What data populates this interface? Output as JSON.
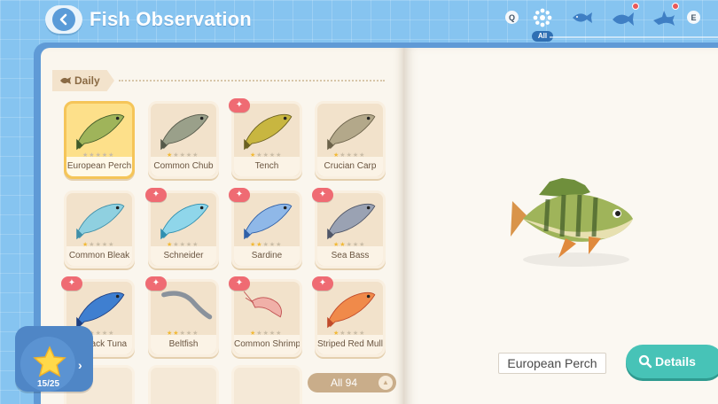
{
  "header": {
    "title": "Fish Observation",
    "key_left": "Q",
    "key_right": "E",
    "all_label": "All"
  },
  "section": {
    "label": "Daily"
  },
  "fish_cards": [
    {
      "name": "European Perch",
      "stars": 0,
      "new": false,
      "selected": true
    },
    {
      "name": "Common Chub",
      "stars": 1,
      "new": false,
      "selected": false
    },
    {
      "name": "Tench",
      "stars": 1,
      "new": true,
      "selected": false
    },
    {
      "name": "Crucian Carp",
      "stars": 1,
      "new": false,
      "selected": false
    },
    {
      "name": "Common Bleak",
      "stars": 1,
      "new": false,
      "selected": false
    },
    {
      "name": "Schneider",
      "stars": 1,
      "new": true,
      "selected": false
    },
    {
      "name": "Sardine",
      "stars": 2,
      "new": true,
      "selected": false
    },
    {
      "name": "Sea Bass",
      "stars": 2,
      "new": true,
      "selected": false
    },
    {
      "name": "Skipjack Tuna",
      "stars": 1,
      "new": true,
      "selected": false
    },
    {
      "name": "Beltfish",
      "stars": 2,
      "new": true,
      "selected": false
    },
    {
      "name": "Common Shrimp",
      "stars": 1,
      "new": true,
      "selected": false
    },
    {
      "name": "Striped Red Mullet",
      "stars": 1,
      "new": true,
      "selected": false
    }
  ],
  "progress": {
    "count": "15/25"
  },
  "filter": {
    "label": "All 94"
  },
  "detail": {
    "name": "European Perch",
    "button": "Details"
  },
  "colors": {
    "accent_teal": "#47c3b7",
    "new_badge": "#ef6b73",
    "selected_card": "#fde08a",
    "sky": "#86c4f0"
  }
}
